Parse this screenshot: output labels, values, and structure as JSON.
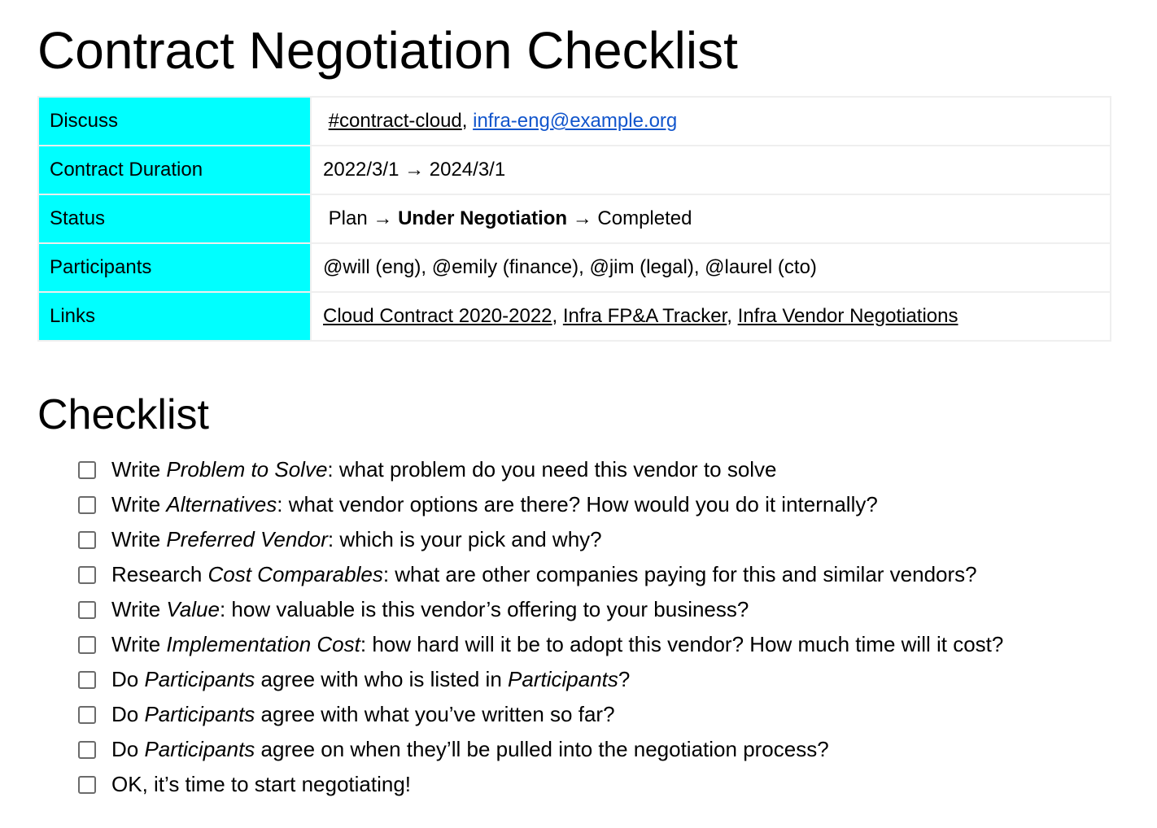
{
  "title": "Contract Negotiation Checklist",
  "meta": {
    "discuss": {
      "label": "Discuss",
      "channel": "#contract-cloud",
      "sep": ", ",
      "email": "infra-eng@example.org"
    },
    "duration": {
      "label": "Contract Duration",
      "value": "2022/3/1 → 2024/3/1"
    },
    "status": {
      "label": "Status",
      "stage1": "Plan",
      "arrow1": " → ",
      "stage2": "Under Negotiation",
      "arrow2": " → ",
      "stage3": "Completed",
      "current": "Under Negotiation"
    },
    "participants": {
      "label": "Participants",
      "value": "@will (eng), @emily (finance), @jim (legal), @laurel (cto)"
    },
    "links": {
      "label": "Links",
      "items": [
        "Cloud Contract 2020-2022",
        "Infra FP&A Tracker",
        "Infra Vendor Negotiations"
      ],
      "sep": ", "
    }
  },
  "checklist": {
    "heading": "Checklist",
    "items": [
      {
        "pre": "Write ",
        "em": "Problem to Solve",
        "post": ": what problem do you need this vendor to solve",
        "em2": "",
        "post2": "",
        "checked": false
      },
      {
        "pre": "Write ",
        "em": "Alternatives",
        "post": ": what vendor options are there? How would you do it internally?",
        "em2": "",
        "post2": "",
        "checked": false
      },
      {
        "pre": "Write ",
        "em": "Preferred Vendor",
        "post": ": which is your pick and why?",
        "em2": "",
        "post2": "",
        "checked": false
      },
      {
        "pre": "Research ",
        "em": "Cost Comparables",
        "post": ": what are other companies paying for this and similar vendors?",
        "em2": "",
        "post2": "",
        "checked": false
      },
      {
        "pre": "Write ",
        "em": "Value",
        "post": ": how valuable is this vendor’s offering to your business?",
        "em2": "",
        "post2": "",
        "checked": false
      },
      {
        "pre": "Write ",
        "em": "Implementation Cost",
        "post": ": how hard will it be to adopt this vendor? How much time will it cost?",
        "em2": "",
        "post2": "",
        "checked": false
      },
      {
        "pre": "Do ",
        "em": "Participants",
        "post": " agree with who is listed in ",
        "em2": "Participants",
        "post2": "?",
        "checked": false
      },
      {
        "pre": "Do ",
        "em": "Participants",
        "post": " agree with what you’ve written so far?",
        "em2": "",
        "post2": "",
        "checked": false
      },
      {
        "pre": "Do ",
        "em": "Participants",
        "post": " agree on when they’ll be pulled into the negotiation process?",
        "em2": "",
        "post2": "",
        "checked": false
      },
      {
        "pre": "OK, it’s time to start negotiating!",
        "em": "",
        "post": "",
        "em2": "",
        "post2": "",
        "checked": false
      }
    ]
  }
}
